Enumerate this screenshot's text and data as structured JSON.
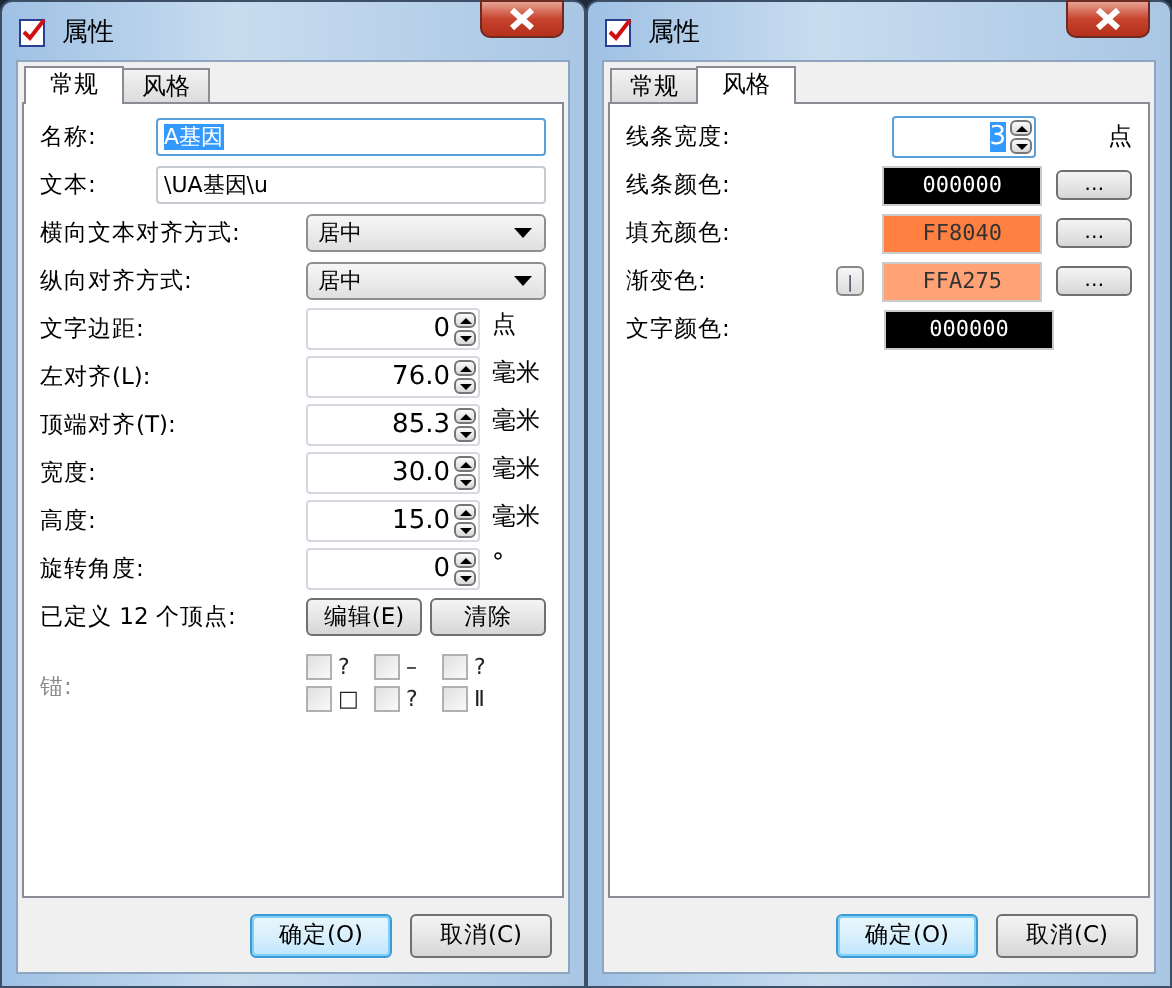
{
  "windows": [
    {
      "title": "属性",
      "tabs": [
        {
          "label": "常规",
          "selected": true
        },
        {
          "label": "风格",
          "selected": false
        }
      ],
      "rows": [
        {
          "kind": "text",
          "label": "名称:",
          "value": "A基因",
          "focused": true
        },
        {
          "kind": "text",
          "label": "文本:",
          "value": "\\UA基因\\u",
          "focused": false
        },
        {
          "kind": "select",
          "label": "横向文本对齐方式:",
          "value": "居中"
        },
        {
          "kind": "select",
          "label": "纵向对齐方式:",
          "value": "居中"
        },
        {
          "kind": "spin",
          "label": "文字边距:",
          "value": "0",
          "unit": "点",
          "focused": false
        },
        {
          "kind": "spin",
          "label": "左对齐(L):",
          "value": "76.0",
          "unit": "毫米",
          "focused": false
        },
        {
          "kind": "spin",
          "label": "顶端对齐(T):",
          "value": "85.3",
          "unit": "毫米",
          "focused": false
        },
        {
          "kind": "spin",
          "label": "宽度:",
          "value": "30.0",
          "unit": "毫米",
          "focused": false
        },
        {
          "kind": "spin",
          "label": "高度:",
          "value": "15.0",
          "unit": "毫米",
          "focused": false
        },
        {
          "kind": "spin",
          "label": "旋转角度:",
          "value": "0",
          "unit": "°",
          "focused": false
        },
        {
          "kind": "buttons",
          "label": "已定义 12 个顶点:",
          "buttons": [
            "编辑(E)",
            "清除"
          ]
        },
        {
          "kind": "anchor",
          "label": "锚:",
          "disabled": true,
          "options": [
            {
              "label": "?",
              "checked": false
            },
            {
              "label": "–",
              "checked": false
            },
            {
              "label": "?",
              "checked": false
            },
            {
              "label": "□",
              "checked": false
            },
            {
              "label": "?",
              "checked": false
            },
            {
              "label": "Ⅱ",
              "checked": false
            }
          ]
        }
      ],
      "buttons": [
        {
          "label": "确定(O)",
          "default": true
        },
        {
          "label": "取消(C)",
          "default": false
        }
      ]
    },
    {
      "title": "属性",
      "tabs": [
        {
          "label": "常规",
          "selected": false
        },
        {
          "label": "风格",
          "selected": true
        }
      ],
      "rows": [
        {
          "kind": "spin",
          "label": "线条宽度:",
          "value": "3",
          "unit": "点",
          "focused": true
        },
        {
          "kind": "color",
          "label": "线条颜色:",
          "value": "000000",
          "button": "…"
        },
        {
          "kind": "color",
          "label": "填充颜色:",
          "value": "FF8040",
          "button": "…"
        },
        {
          "kind": "color",
          "label": "渐变色:",
          "value": "FFA275",
          "button": "…",
          "toggle": "|"
        },
        {
          "kind": "color",
          "label": "文字颜色:",
          "value": "000000"
        }
      ],
      "buttons": [
        {
          "label": "确定(O)",
          "default": true
        },
        {
          "label": "取消(C)",
          "default": false
        }
      ]
    }
  ]
}
